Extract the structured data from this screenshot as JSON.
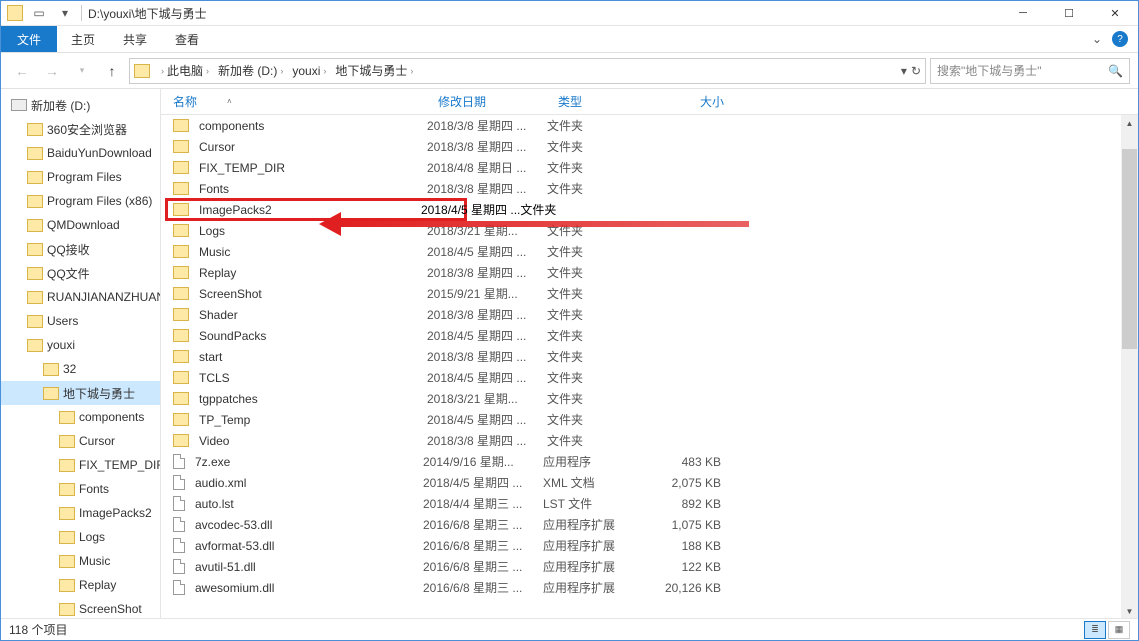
{
  "title_path": "D:\\youxi\\地下城与勇士",
  "ribbon": {
    "file": "文件",
    "home": "主页",
    "share": "共享",
    "view": "查看"
  },
  "breadcrumbs": [
    "此电脑",
    "新加卷 (D:)",
    "youxi",
    "地下城与勇士"
  ],
  "search_placeholder": "搜索\"地下城与勇士\"",
  "tree": [
    {
      "label": "新加卷 (D:)",
      "type": "drive",
      "lvl": 0
    },
    {
      "label": "360安全浏览器",
      "type": "folder",
      "lvl": 1
    },
    {
      "label": "BaiduYunDownload",
      "type": "folder",
      "lvl": 1
    },
    {
      "label": "Program Files",
      "type": "folder",
      "lvl": 1
    },
    {
      "label": "Program Files (x86)",
      "type": "folder",
      "lvl": 1
    },
    {
      "label": "QMDownload",
      "type": "folder",
      "lvl": 1
    },
    {
      "label": "QQ接收",
      "type": "folder",
      "lvl": 1
    },
    {
      "label": "QQ文件",
      "type": "folder",
      "lvl": 1
    },
    {
      "label": "RUANJIANANZHUANG",
      "type": "folder",
      "lvl": 1
    },
    {
      "label": "Users",
      "type": "folder",
      "lvl": 1
    },
    {
      "label": "youxi",
      "type": "folder",
      "lvl": 1
    },
    {
      "label": "32",
      "type": "folder",
      "lvl": 2
    },
    {
      "label": "地下城与勇士",
      "type": "folder",
      "lvl": 2,
      "sel": true
    },
    {
      "label": "components",
      "type": "folder",
      "lvl": 3
    },
    {
      "label": "Cursor",
      "type": "folder",
      "lvl": 3
    },
    {
      "label": "FIX_TEMP_DIR",
      "type": "folder",
      "lvl": 3
    },
    {
      "label": "Fonts",
      "type": "folder",
      "lvl": 3
    },
    {
      "label": "ImagePacks2",
      "type": "folder",
      "lvl": 3
    },
    {
      "label": "Logs",
      "type": "folder",
      "lvl": 3
    },
    {
      "label": "Music",
      "type": "folder",
      "lvl": 3
    },
    {
      "label": "Replay",
      "type": "folder",
      "lvl": 3
    },
    {
      "label": "ScreenShot",
      "type": "folder",
      "lvl": 3
    }
  ],
  "columns": {
    "name": "名称",
    "date": "修改日期",
    "type": "类型",
    "size": "大小"
  },
  "rows": [
    {
      "n": "components",
      "d": "2018/3/8 星期四 ...",
      "t": "文件夹",
      "s": "",
      "k": "folder"
    },
    {
      "n": "Cursor",
      "d": "2018/3/8 星期四 ...",
      "t": "文件夹",
      "s": "",
      "k": "folder"
    },
    {
      "n": "FIX_TEMP_DIR",
      "d": "2018/4/8 星期日 ...",
      "t": "文件夹",
      "s": "",
      "k": "folder"
    },
    {
      "n": "Fonts",
      "d": "2018/3/8 星期四 ...",
      "t": "文件夹",
      "s": "",
      "k": "folder"
    },
    {
      "n": "ImagePacks2",
      "d": "2018/4/5 星期四 ...",
      "t": "文件夹",
      "s": "",
      "k": "folder",
      "hl": true
    },
    {
      "n": "Logs",
      "d": "2018/3/21 星期...",
      "t": "文件夹",
      "s": "",
      "k": "folder"
    },
    {
      "n": "Music",
      "d": "2018/4/5 星期四 ...",
      "t": "文件夹",
      "s": "",
      "k": "folder"
    },
    {
      "n": "Replay",
      "d": "2018/3/8 星期四 ...",
      "t": "文件夹",
      "s": "",
      "k": "folder"
    },
    {
      "n": "ScreenShot",
      "d": "2015/9/21 星期...",
      "t": "文件夹",
      "s": "",
      "k": "folder"
    },
    {
      "n": "Shader",
      "d": "2018/3/8 星期四 ...",
      "t": "文件夹",
      "s": "",
      "k": "folder"
    },
    {
      "n": "SoundPacks",
      "d": "2018/4/5 星期四 ...",
      "t": "文件夹",
      "s": "",
      "k": "folder"
    },
    {
      "n": "start",
      "d": "2018/3/8 星期四 ...",
      "t": "文件夹",
      "s": "",
      "k": "folder"
    },
    {
      "n": "TCLS",
      "d": "2018/4/5 星期四 ...",
      "t": "文件夹",
      "s": "",
      "k": "folder"
    },
    {
      "n": "tgppatches",
      "d": "2018/3/21 星期...",
      "t": "文件夹",
      "s": "",
      "k": "folder"
    },
    {
      "n": "TP_Temp",
      "d": "2018/4/5 星期四 ...",
      "t": "文件夹",
      "s": "",
      "k": "folder"
    },
    {
      "n": "Video",
      "d": "2018/3/8 星期四 ...",
      "t": "文件夹",
      "s": "",
      "k": "folder"
    },
    {
      "n": "7z.exe",
      "d": "2014/9/16 星期...",
      "t": "应用程序",
      "s": "483 KB",
      "k": "file"
    },
    {
      "n": "audio.xml",
      "d": "2018/4/5 星期四 ...",
      "t": "XML 文档",
      "s": "2,075 KB",
      "k": "file"
    },
    {
      "n": "auto.lst",
      "d": "2018/4/4 星期三 ...",
      "t": "LST 文件",
      "s": "892 KB",
      "k": "file"
    },
    {
      "n": "avcodec-53.dll",
      "d": "2016/6/8 星期三 ...",
      "t": "应用程序扩展",
      "s": "1,075 KB",
      "k": "file"
    },
    {
      "n": "avformat-53.dll",
      "d": "2016/6/8 星期三 ...",
      "t": "应用程序扩展",
      "s": "188 KB",
      "k": "file"
    },
    {
      "n": "avutil-51.dll",
      "d": "2016/6/8 星期三 ...",
      "t": "应用程序扩展",
      "s": "122 KB",
      "k": "file"
    },
    {
      "n": "awesomium.dll",
      "d": "2016/6/8 星期三 ...",
      "t": "应用程序扩展",
      "s": "20,126 KB",
      "k": "file"
    }
  ],
  "status": "118 个项目"
}
